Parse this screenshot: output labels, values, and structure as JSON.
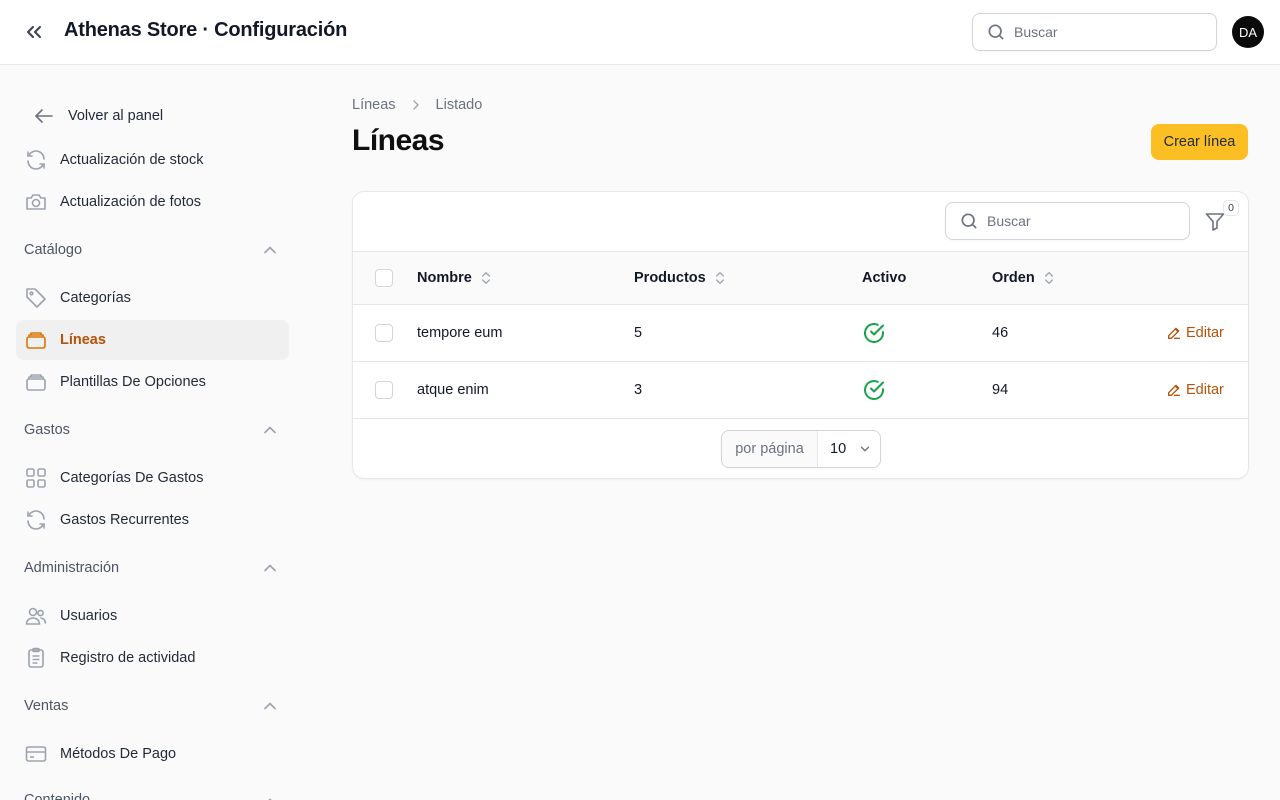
{
  "header": {
    "title": "Athenas Store · Configuración",
    "search_placeholder": "Buscar",
    "avatar_initials": "DA"
  },
  "sidebar": {
    "top_items": [
      {
        "label": "Volver al panel",
        "icon": "arrow-left-icon"
      },
      {
        "label": "Actualización de stock",
        "icon": "refresh-icon"
      },
      {
        "label": "Actualización de fotos",
        "icon": "camera-icon"
      }
    ],
    "groups": [
      {
        "label": "Catálogo",
        "items": [
          {
            "label": "Categorías",
            "icon": "tag-icon"
          },
          {
            "label": "Líneas",
            "icon": "stack-icon",
            "active": true
          },
          {
            "label": "Plantillas De Opciones",
            "icon": "stack-icon"
          }
        ]
      },
      {
        "label": "Gastos",
        "items": [
          {
            "label": "Categorías De Gastos",
            "icon": "grid-icon"
          },
          {
            "label": "Gastos Recurrentes",
            "icon": "refresh-icon"
          }
        ]
      },
      {
        "label": "Administración",
        "items": [
          {
            "label": "Usuarios",
            "icon": "users-icon"
          },
          {
            "label": "Registro de actividad",
            "icon": "clipboard-icon"
          }
        ]
      },
      {
        "label": "Ventas",
        "items": [
          {
            "label": "Métodos De Pago",
            "icon": "credit-card-icon"
          }
        ]
      },
      {
        "label": "Contenido",
        "items": []
      }
    ],
    "accent_color": "#d97706"
  },
  "main": {
    "breadcrumb": [
      "Líneas",
      "Listado"
    ],
    "title": "Líneas",
    "create_button": "Crear línea",
    "table": {
      "search_placeholder": "Buscar",
      "filter_count": "0",
      "columns": [
        "Nombre",
        "Productos",
        "Activo",
        "Orden"
      ],
      "rows": [
        {
          "nombre": "tempore eum",
          "productos": "5",
          "activo": true,
          "orden": "46",
          "action": "Editar"
        },
        {
          "nombre": "atque enim",
          "productos": "3",
          "activo": true,
          "orden": "94",
          "action": "Editar"
        }
      ],
      "per_page_label": "por página",
      "per_page_value": "10"
    }
  },
  "colors": {
    "primary_button": "#fbbf24",
    "active_green": "#16a34a",
    "link": "#b45309"
  }
}
